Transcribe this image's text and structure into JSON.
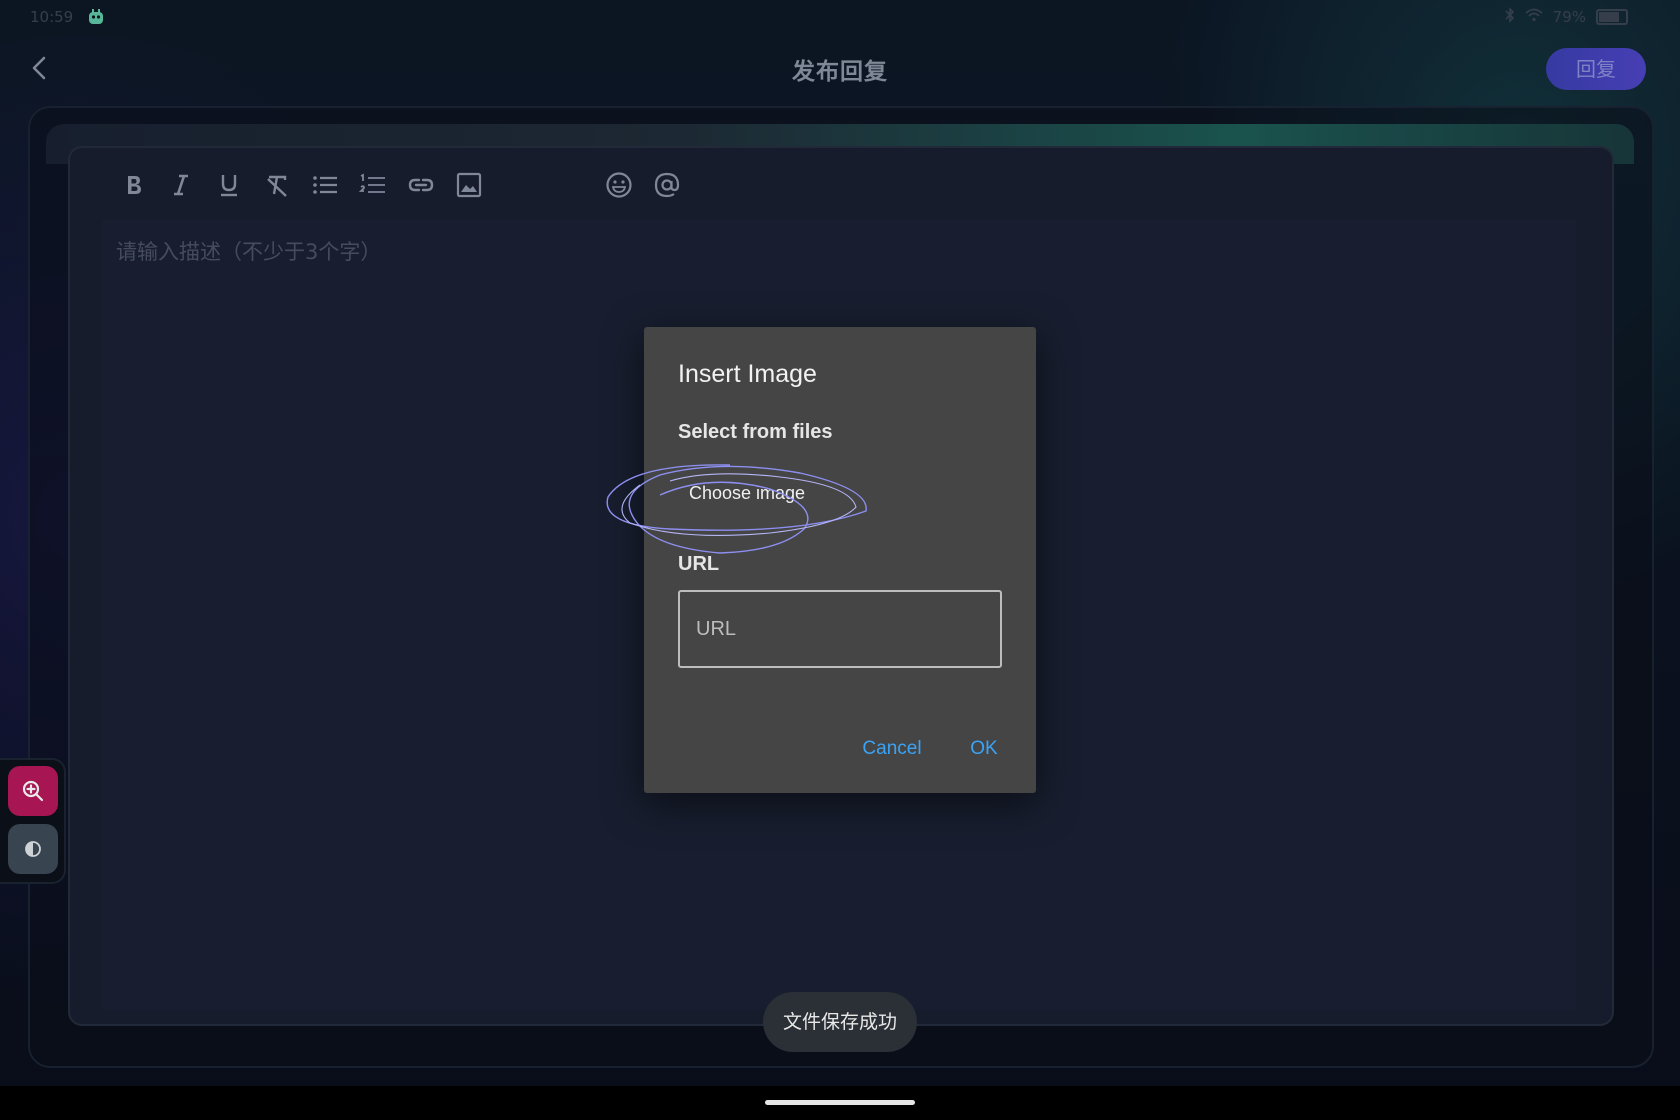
{
  "status_bar": {
    "time": "10:59",
    "battery": "79%"
  },
  "header": {
    "title": "发布回复",
    "reply_label": "回复"
  },
  "toolbar": {
    "buttons": [
      "bold-icon",
      "italic-icon",
      "underline-icon",
      "clear-format-icon",
      "bullet-list-icon",
      "numbered-list-icon",
      "link-icon",
      "image-icon",
      "emoji-icon",
      "mention-icon"
    ]
  },
  "editor": {
    "placeholder": "请输入描述（不少于3个字）"
  },
  "dialog": {
    "title": "Insert Image",
    "select_label": "Select from files",
    "choose_label": "Choose image",
    "url_label": "URL",
    "url_placeholder": "URL",
    "url_value": "",
    "cancel_label": "Cancel",
    "ok_label": "OK"
  },
  "toast": {
    "message": "文件保存成功"
  },
  "colors": {
    "accent_blue": "#3ba3f5",
    "reply_button": "#3b3fb0",
    "zoom_button": "#b6175a",
    "dialog_bg": "#454545"
  }
}
